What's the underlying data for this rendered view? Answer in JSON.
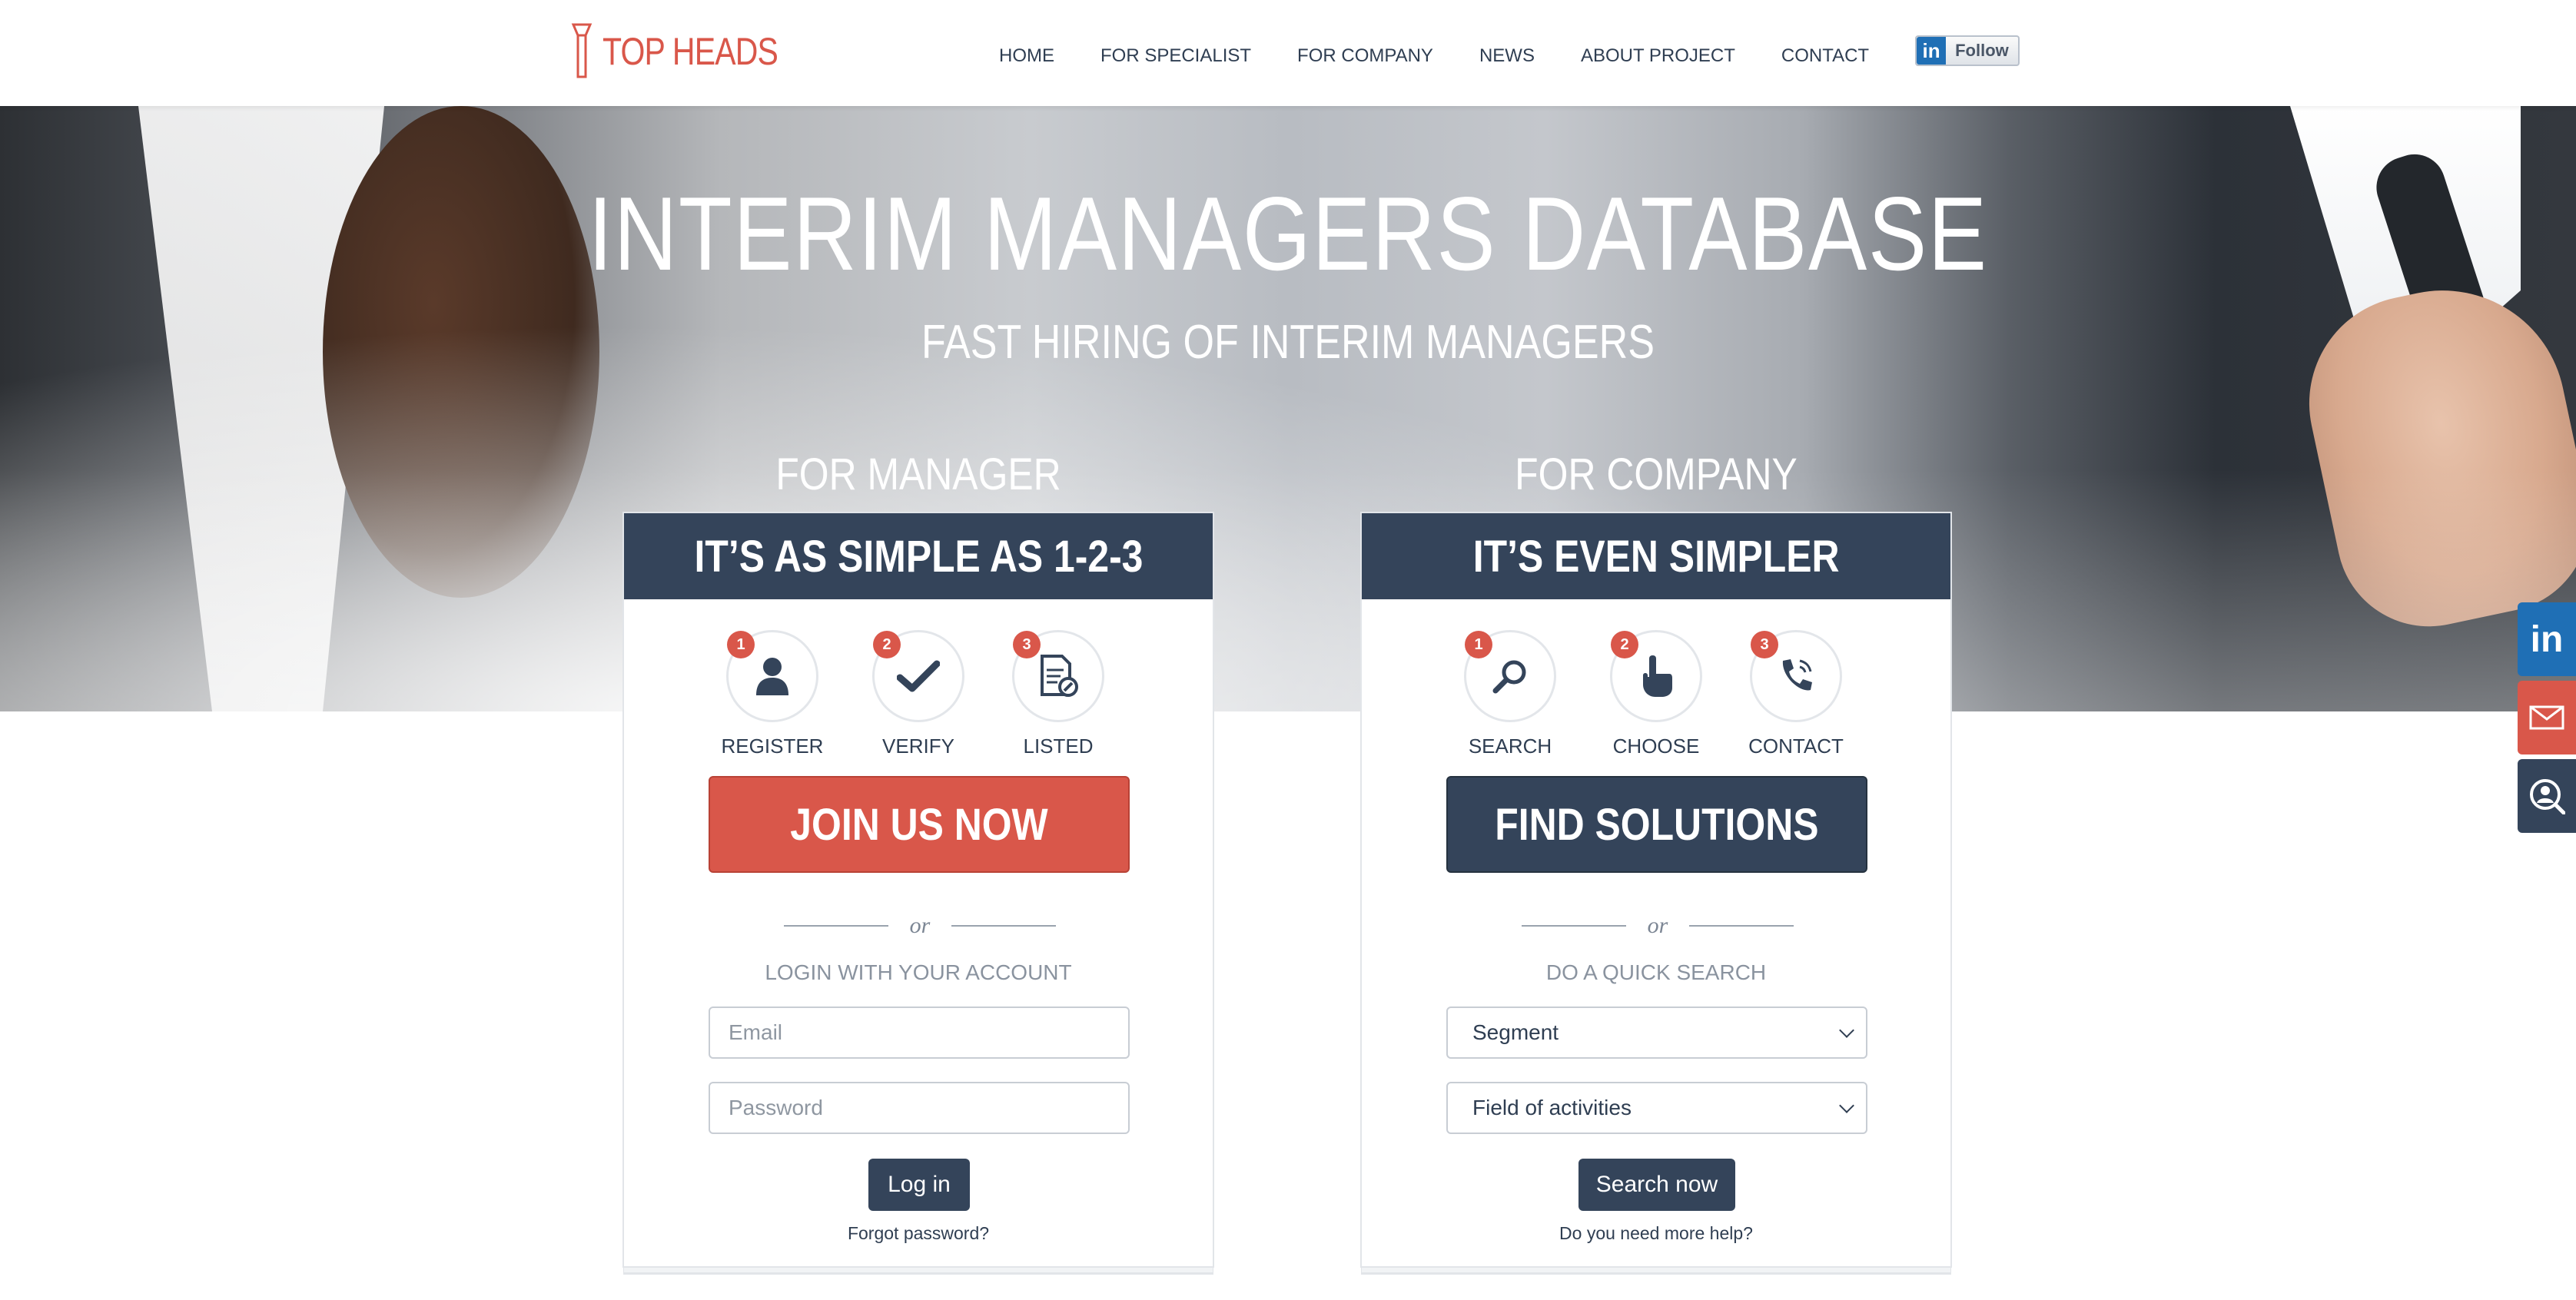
{
  "brand": {
    "name": "TOP HEADS",
    "accent": "#d9574a",
    "navy": "#34445a"
  },
  "nav": {
    "items": [
      {
        "label": "HOME",
        "active": true
      },
      {
        "label": "FOR SPECIALIST",
        "active": false
      },
      {
        "label": "FOR COMPANY",
        "active": false
      },
      {
        "label": "NEWS",
        "active": false
      },
      {
        "label": "ABOUT PROJECT",
        "active": false
      },
      {
        "label": "CONTACT",
        "active": false
      }
    ],
    "follow": {
      "icon": "linkedin-icon",
      "logo_text": "in",
      "label": "Follow"
    }
  },
  "hero": {
    "title": "INTERIM MANAGERS DATABASE",
    "subtitle": "FAST HIRING OF INTERIM MANAGERS"
  },
  "manager": {
    "heading": "FOR MANAGER",
    "bar": "IT’S AS SIMPLE AS 1-2-3",
    "steps": [
      {
        "num": "1",
        "label": "REGISTER",
        "icon": "user-icon"
      },
      {
        "num": "2",
        "label": "VERIFY",
        "icon": "checkmark-icon"
      },
      {
        "num": "3",
        "label": "LISTED",
        "icon": "document-icon"
      }
    ],
    "cta": "JOIN US NOW",
    "or": "or",
    "caption": "LOGIN WITH YOUR ACCOUNT",
    "email_placeholder": "Email",
    "password_placeholder": "Password",
    "login_button": "Log in",
    "forgot": "Forgot password?"
  },
  "company": {
    "heading": "FOR COMPANY",
    "bar": "IT’S EVEN SIMPLER",
    "steps": [
      {
        "num": "1",
        "label": "SEARCH",
        "icon": "search-icon"
      },
      {
        "num": "2",
        "label": "CHOOSE",
        "icon": "pointer-hand-icon"
      },
      {
        "num": "3",
        "label": "CONTACT",
        "icon": "phone-icon"
      }
    ],
    "cta": "FIND SOLUTIONS",
    "or": "or",
    "caption": "DO A QUICK SEARCH",
    "segment_select": "Segment",
    "field_select": "Field of activities",
    "search_button": "Search now",
    "help": "Do you need more help?"
  },
  "side_social": {
    "linkedin": {
      "icon": "linkedin-icon",
      "text": "in"
    },
    "mail": {
      "icon": "mail-icon"
    },
    "search": {
      "icon": "user-search-icon"
    }
  }
}
